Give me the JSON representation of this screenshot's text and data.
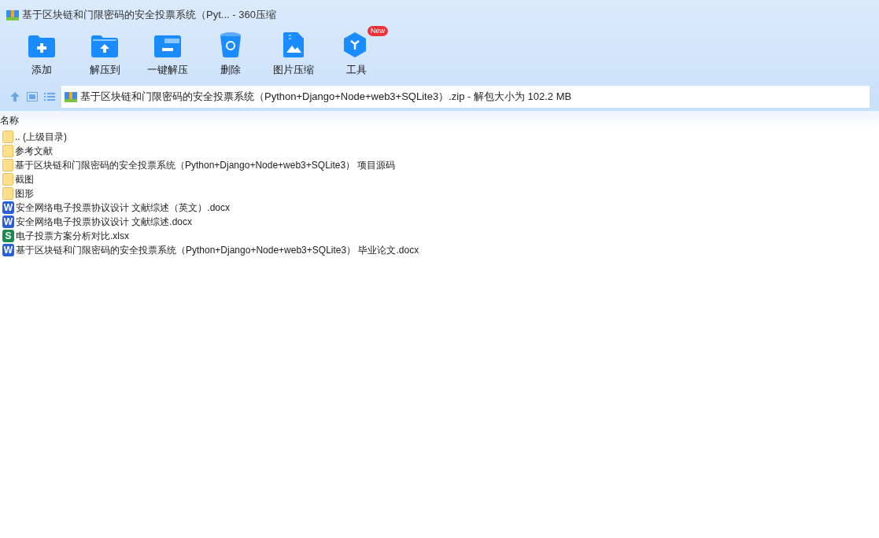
{
  "window": {
    "title": "基于区块链和门限密码的安全投票系统（Pyt... - 360压缩"
  },
  "toolbar": [
    {
      "kind": "add",
      "label": "添加"
    },
    {
      "kind": "extract-to",
      "label": "解压到"
    },
    {
      "kind": "extract",
      "label": "一键解压"
    },
    {
      "kind": "delete",
      "label": "删除"
    },
    {
      "kind": "image",
      "label": "图片压缩"
    },
    {
      "kind": "tools",
      "label": "工具",
      "badge": "New"
    }
  ],
  "address_bar": {
    "path": "基于区块链和门限密码的安全投票系统（Python+Django+Node+web3+SQLite3）.zip - 解包大小为 102.2 MB"
  },
  "file_list": {
    "columns": [
      "名称"
    ],
    "rows": [
      {
        "kind": "folder",
        "name": ".. (上级目录)"
      },
      {
        "kind": "folder",
        "name": "参考文献"
      },
      {
        "kind": "folder",
        "name": "基于区块链和门限密码的安全投票系统（Python+Django+Node+web3+SQLite3） 项目源码"
      },
      {
        "kind": "folder",
        "name": "截图"
      },
      {
        "kind": "folder",
        "name": "图形"
      },
      {
        "kind": "word",
        "icon_letter": "W",
        "name": "安全网络电子投票协议设计 文献综述（英文）.docx"
      },
      {
        "kind": "word",
        "icon_letter": "W",
        "name": "安全网络电子投票协议设计 文献综述.docx"
      },
      {
        "kind": "sheet",
        "icon_letter": "S",
        "name": "电子投票方案分析对比.xlsx"
      },
      {
        "kind": "word",
        "icon_letter": "W",
        "name": "基于区块链和门限密码的安全投票系统（Python+Django+Node+web3+SQLite3） 毕业论文.docx"
      }
    ]
  }
}
